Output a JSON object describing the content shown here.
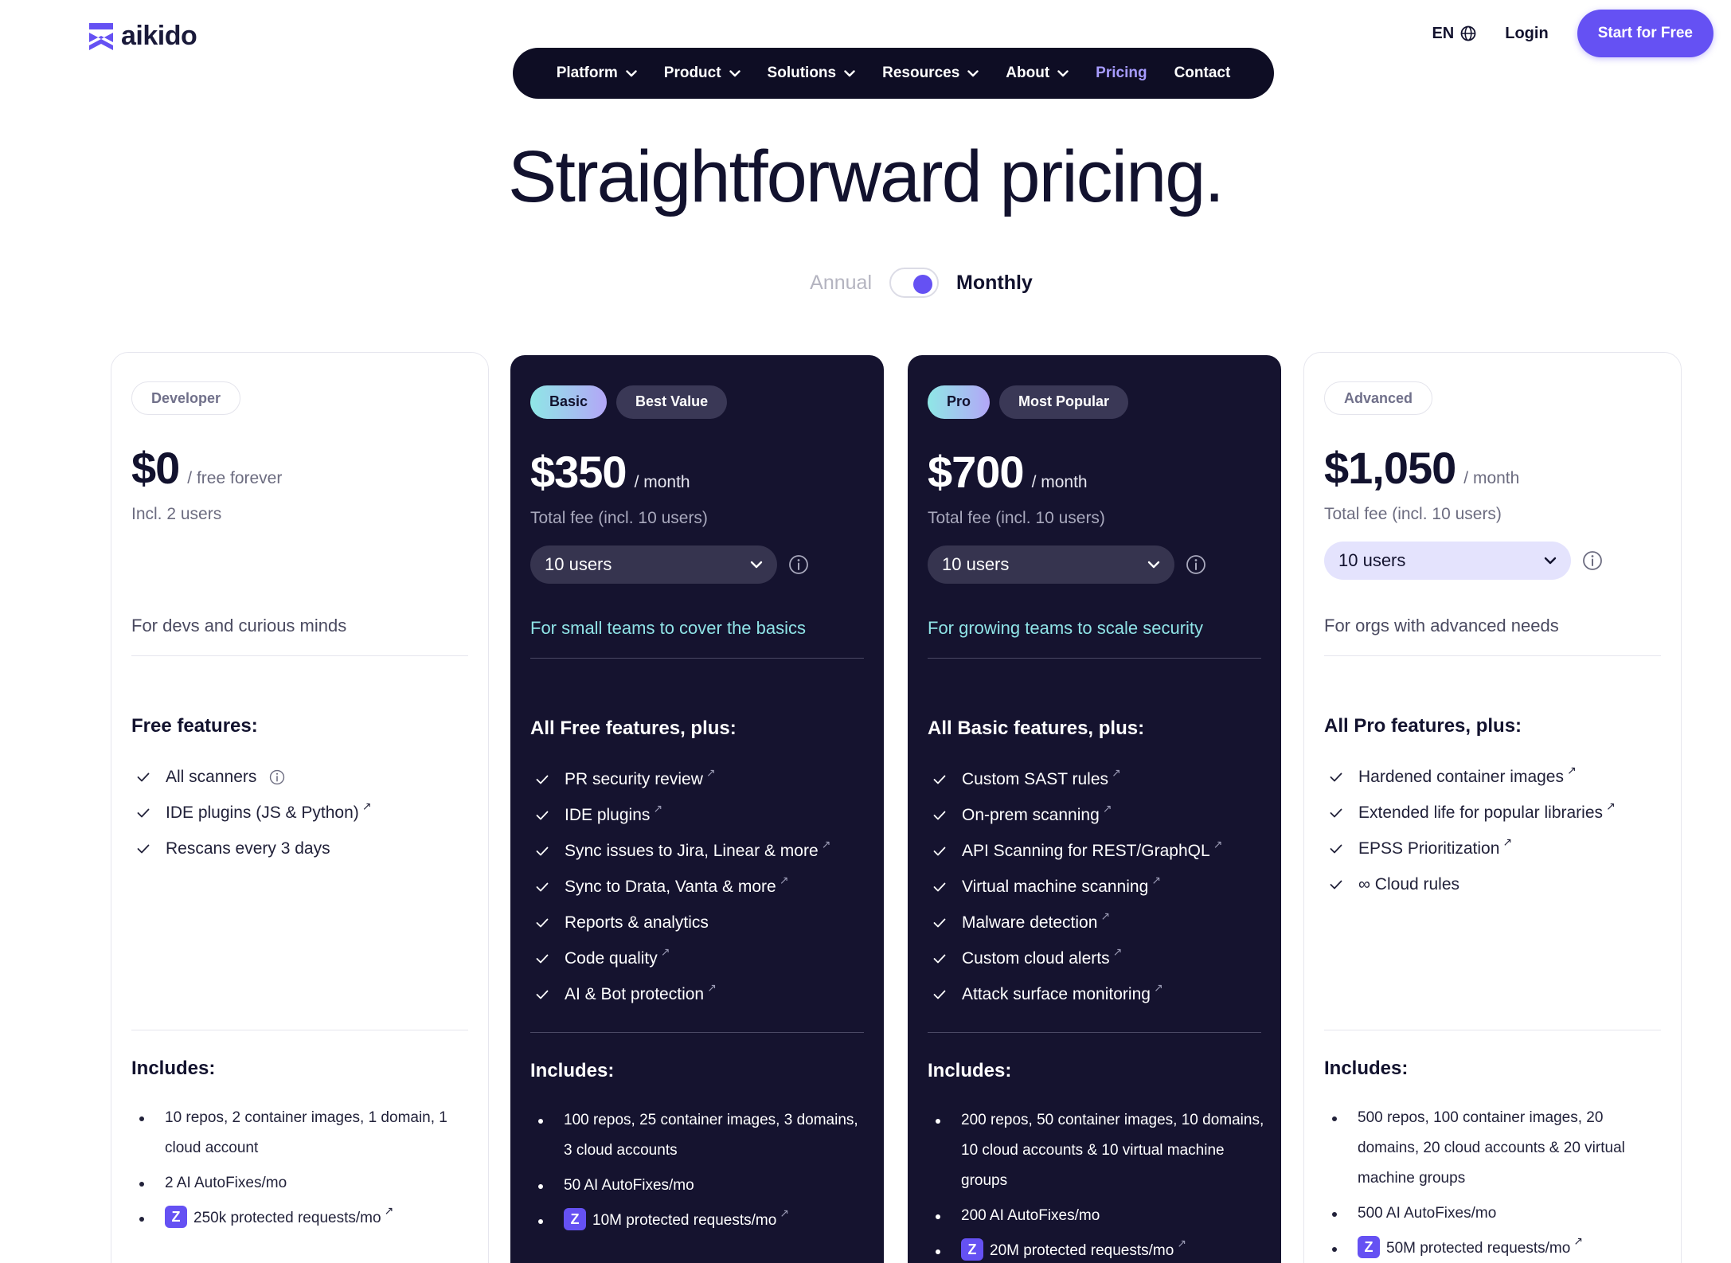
{
  "brand": {
    "name": "aikido"
  },
  "header": {
    "lang": "EN",
    "login": "Login",
    "cta": "Start for Free"
  },
  "nav": {
    "items": [
      {
        "label": "Platform",
        "dropdown": true
      },
      {
        "label": "Product",
        "dropdown": true
      },
      {
        "label": "Solutions",
        "dropdown": true
      },
      {
        "label": "Resources",
        "dropdown": true
      },
      {
        "label": "About",
        "dropdown": true
      },
      {
        "label": "Pricing",
        "dropdown": false,
        "active": true
      },
      {
        "label": "Contact",
        "dropdown": false
      }
    ]
  },
  "hero": {
    "title": "Straightforward pricing."
  },
  "billing": {
    "annual": "Annual",
    "monthly": "Monthly",
    "selected": "Monthly"
  },
  "colors": {
    "accent": "#6551f3",
    "dark_card": "#15132f",
    "nav_bg": "#0e0d24",
    "active_nav": "#a79cff",
    "tagline_teal": "#8fe3e6"
  },
  "plans": [
    {
      "name": "Developer",
      "tag": "",
      "price": "$0",
      "period": "/ free forever",
      "sub": "Incl. 2 users",
      "select": "",
      "tagline": "For devs and curious minds",
      "features_title": "Free features:",
      "features": [
        "All scanners",
        "IDE plugins (JS & Python)",
        "Rescans every 3 days"
      ],
      "includes_title": "Includes:",
      "includes": [
        "10 repos, 2 container images, 1 domain, 1 cloud account",
        "2 AI AutoFixes/mo",
        "250k protected requests/mo"
      ]
    },
    {
      "name": "Basic",
      "tag": "Best Value",
      "price": "$350",
      "period": "/ month",
      "sub": "Total fee (incl. 10 users)",
      "select": "10 users",
      "tagline": "For small teams to cover the basics",
      "features_title": "All Free features, plus:",
      "features": [
        "PR security review",
        "IDE plugins",
        "Sync issues to Jira, Linear & more",
        "Sync to Drata, Vanta & more",
        "Reports & analytics",
        "Code quality",
        "AI & Bot protection"
      ],
      "includes_title": "Includes:",
      "includes": [
        "100 repos, 25 container images, 3 domains, 3 cloud accounts",
        "50 AI AutoFixes/mo",
        "10M protected requests/mo"
      ]
    },
    {
      "name": "Pro",
      "tag": "Most Popular",
      "price": "$700",
      "period": "/ month",
      "sub": "Total fee (incl. 10 users)",
      "select": "10 users",
      "tagline": "For growing teams to scale security",
      "features_title": "All Basic features, plus:",
      "features": [
        "Custom SAST rules",
        "On-prem scanning",
        "API Scanning for REST/GraphQL",
        "Virtual machine scanning",
        "Malware detection",
        "Custom cloud alerts",
        "Attack surface monitoring"
      ],
      "includes_title": "Includes:",
      "includes": [
        "200 repos, 50 container images, 10 domains, 10 cloud accounts & 10 virtual machine groups",
        "200 AI AutoFixes/mo",
        "20M protected requests/mo"
      ]
    },
    {
      "name": "Advanced",
      "tag": "",
      "price": "$1,050",
      "period": "/ month",
      "sub": "Total fee (incl. 10 users)",
      "select": "10 users",
      "tagline": "For orgs with advanced needs",
      "features_title": "All Pro features, plus:",
      "features": [
        "Hardened container images",
        "Extended life for popular libraries",
        "EPSS Prioritization",
        "∞ Cloud rules"
      ],
      "includes_title": "Includes:",
      "includes": [
        "500 repos, 100 container images, 20 domains, 20 cloud accounts & 20 virtual machine groups",
        "500 AI AutoFixes/mo",
        "50M protected requests/mo"
      ]
    }
  ]
}
